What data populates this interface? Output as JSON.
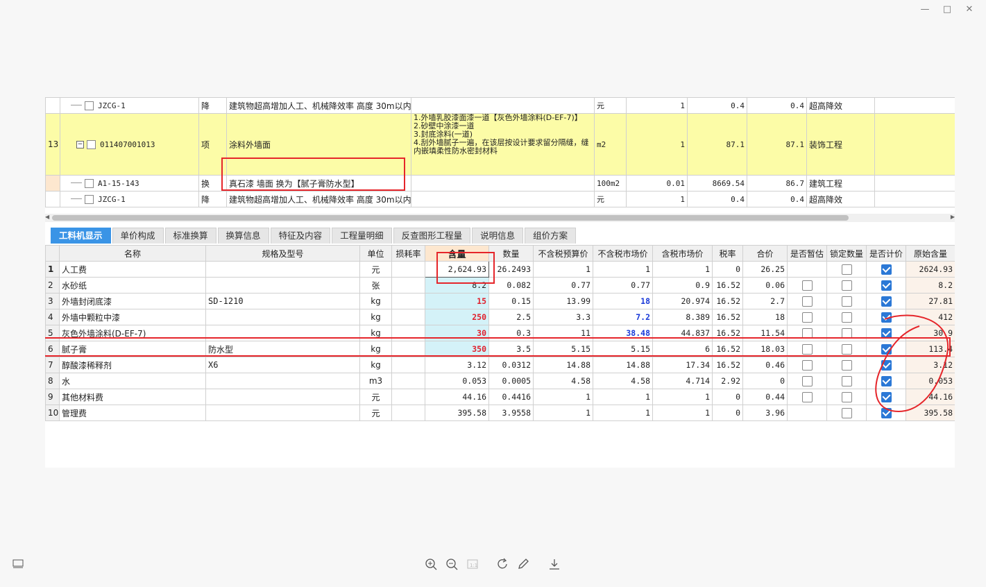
{
  "window_controls": {
    "minimize": "—",
    "maximize": "□",
    "close": "✕"
  },
  "top_rows": [
    {
      "row": "",
      "code": "JZCG-1",
      "type": "降",
      "name": "建筑物超高增加人工、机械降效率 高度 30m以内",
      "desc": "",
      "unit": "元",
      "qty": "1",
      "price": "0.4",
      "total": "0.4",
      "category": "超高降效"
    },
    {
      "row": "13",
      "code": "011407001013",
      "type": "项",
      "name": "涂料外墙面",
      "desc": "1.外墙乳胶漆面漆一道【灰色外墙涂料(D-EF-7)】\n2.砂壁中涂漆一道\n3.封底涂料(一道)\n4.刮外墙腻子一遍，在该层按设计要求留分隔缝，缝内嵌填柔性防水密封材料",
      "unit": "m2",
      "qty": "1",
      "price": "87.1",
      "total": "87.1",
      "category": "装饰工程"
    },
    {
      "row": "",
      "code": "A1-15-143",
      "type": "换",
      "name": "真石漆 墙面  换为【腻子膏防水型】",
      "desc": "",
      "unit": "100m2",
      "qty": "0.01",
      "price": "8669.54",
      "total": "86.7",
      "category": "建筑工程"
    },
    {
      "row": "",
      "code": "JZCG-1",
      "type": "降",
      "name": "建筑物超高增加人工、机械降效率 高度 30m以内",
      "desc": "",
      "unit": "元",
      "qty": "1",
      "price": "0.4",
      "total": "0.4",
      "category": "超高降效"
    }
  ],
  "tabs": [
    "工料机显示",
    "单价构成",
    "标准换算",
    "换算信息",
    "特征及内容",
    "工程量明细",
    "反查图形工程量",
    "说明信息",
    "组价方案"
  ],
  "columns": [
    "名称",
    "规格及型号",
    "单位",
    "损耗率",
    "含量",
    "数量",
    "不含税预算价",
    "不含税市场价",
    "含税市场价",
    "税率",
    "合价",
    "是否暂估",
    "锁定数量",
    "是否计价",
    "原始含量"
  ],
  "rows": [
    {
      "no": "1",
      "name": "人工费",
      "spec": "",
      "unit": "元",
      "loss": "",
      "content": "2,624.93",
      "qty": "26.2493",
      "budget": "1",
      "market": "1",
      "taxmarket": "1",
      "rate": "0",
      "total": "26.25",
      "temp": null,
      "lock": false,
      "price": true,
      "orig": "2624.93"
    },
    {
      "no": "2",
      "name": "水砂纸",
      "spec": "",
      "unit": "张",
      "loss": "",
      "content": "8.2",
      "qty": "0.082",
      "budget": "0.77",
      "market": "0.77",
      "taxmarket": "0.9",
      "rate": "16.52",
      "total": "0.06",
      "temp": false,
      "lock": false,
      "price": true,
      "orig": "8.2"
    },
    {
      "no": "3",
      "name": "外墙封闭底漆",
      "spec": "SD-1210",
      "unit": "kg",
      "loss": "",
      "content": "15",
      "qty": "0.15",
      "budget": "13.99",
      "market": "18",
      "taxmarket": "20.974",
      "rate": "16.52",
      "total": "2.7",
      "temp": false,
      "lock": false,
      "price": true,
      "orig": "27.81"
    },
    {
      "no": "4",
      "name": "外墙中颗粒中漆",
      "spec": "",
      "unit": "kg",
      "loss": "",
      "content": "250",
      "qty": "2.5",
      "budget": "3.3",
      "market": "7.2",
      "taxmarket": "8.389",
      "rate": "16.52",
      "total": "18",
      "temp": false,
      "lock": false,
      "price": true,
      "orig": "412"
    },
    {
      "no": "5",
      "name": "灰色外墙涂料(D-EF-7)",
      "spec": "",
      "unit": "kg",
      "loss": "",
      "content": "30",
      "qty": "0.3",
      "budget": "11",
      "market": "38.48",
      "taxmarket": "44.837",
      "rate": "16.52",
      "total": "11.54",
      "temp": false,
      "lock": false,
      "price": true,
      "orig": "30.9"
    },
    {
      "no": "6",
      "name": "腻子膏",
      "spec": "防水型",
      "unit": "kg",
      "loss": "",
      "content": "350",
      "qty": "3.5",
      "budget": "5.15",
      "market": "5.15",
      "taxmarket": "6",
      "rate": "16.52",
      "total": "18.03",
      "temp": false,
      "lock": false,
      "price": true,
      "orig": "113.4"
    },
    {
      "no": "7",
      "name": "醇酸漆稀释剂",
      "spec": "X6",
      "unit": "kg",
      "loss": "",
      "content": "3.12",
      "qty": "0.0312",
      "budget": "14.88",
      "market": "14.88",
      "taxmarket": "17.34",
      "rate": "16.52",
      "total": "0.46",
      "temp": false,
      "lock": false,
      "price": true,
      "orig": "3.12"
    },
    {
      "no": "8",
      "name": "水",
      "spec": "",
      "unit": "m3",
      "loss": "",
      "content": "0.053",
      "qty": "0.0005",
      "budget": "4.58",
      "market": "4.58",
      "taxmarket": "4.714",
      "rate": "2.92",
      "total": "0",
      "temp": false,
      "lock": false,
      "price": true,
      "orig": "0.053"
    },
    {
      "no": "9",
      "name": "其他材料费",
      "spec": "",
      "unit": "元",
      "loss": "",
      "content": "44.16",
      "qty": "0.4416",
      "budget": "1",
      "market": "1",
      "taxmarket": "1",
      "rate": "0",
      "total": "0.44",
      "temp": false,
      "lock": false,
      "price": true,
      "orig": "44.16"
    },
    {
      "no": "10",
      "name": "管理费",
      "spec": "",
      "unit": "元",
      "loss": "",
      "content": "395.58",
      "qty": "3.9558",
      "budget": "1",
      "market": "1",
      "taxmarket": "1",
      "rate": "0",
      "total": "3.96",
      "temp": null,
      "lock": false,
      "price": true,
      "orig": "395.58"
    }
  ],
  "viewer_toolbar": [
    "zoom-in-icon",
    "zoom-out-icon",
    "fit-icon",
    "rotate-icon",
    "edit-icon",
    "download-icon"
  ],
  "colors": {
    "tab_active": "#3a94e6",
    "highlight_row": "#fcfca7",
    "annotation": "#e5252a",
    "content_cell": "#d4f2f8",
    "red_value": "#e0202c",
    "blue_value": "#1a3ad9"
  }
}
